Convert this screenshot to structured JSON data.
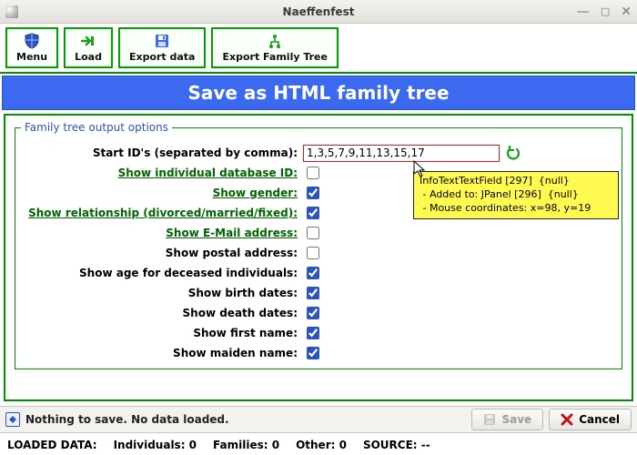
{
  "window": {
    "title": "Naeffenfest"
  },
  "toolbar": {
    "menu": "Menu",
    "load": "Load",
    "export_data": "Export data",
    "export_family_tree": "Export Family Tree"
  },
  "header": {
    "title": "Save as HTML family tree"
  },
  "options": {
    "legend": "Family tree output options",
    "start_ids_label": "Start ID's (separated by comma):",
    "start_ids_value": "1,3,5,7,9,11,13,15,17",
    "rows": [
      {
        "label": "Show individual database ID:",
        "link": true,
        "checked": false
      },
      {
        "label": "Show gender:",
        "link": true,
        "checked": true
      },
      {
        "label": "Show relationship (divorced/married/fixed):",
        "link": true,
        "checked": true
      },
      {
        "label": "Show E-Mail address:",
        "link": true,
        "checked": false
      },
      {
        "label": "Show postal address:",
        "link": false,
        "checked": false
      },
      {
        "label": "Show age for deceased individuals:",
        "link": false,
        "checked": true
      },
      {
        "label": "Show birth dates:",
        "link": false,
        "checked": true
      },
      {
        "label": "Show death dates:",
        "link": false,
        "checked": true
      },
      {
        "label": "Show first name:",
        "link": false,
        "checked": true
      },
      {
        "label": "Show maiden name:",
        "link": false,
        "checked": true
      }
    ]
  },
  "tooltip": {
    "text": "InfoTextTextField [297]  {null}\n - Added to: JPanel [296]  {null}\n - Mouse coordinates: x=98, y=19"
  },
  "status": {
    "text": "Nothing to save. No data loaded.",
    "save_label": "Save",
    "cancel_label": "Cancel"
  },
  "footer": {
    "loaded": "LOADED DATA:",
    "individuals": "Individuals: 0",
    "families": "Families: 0",
    "other": "Other: 0",
    "source": "SOURCE: --"
  }
}
